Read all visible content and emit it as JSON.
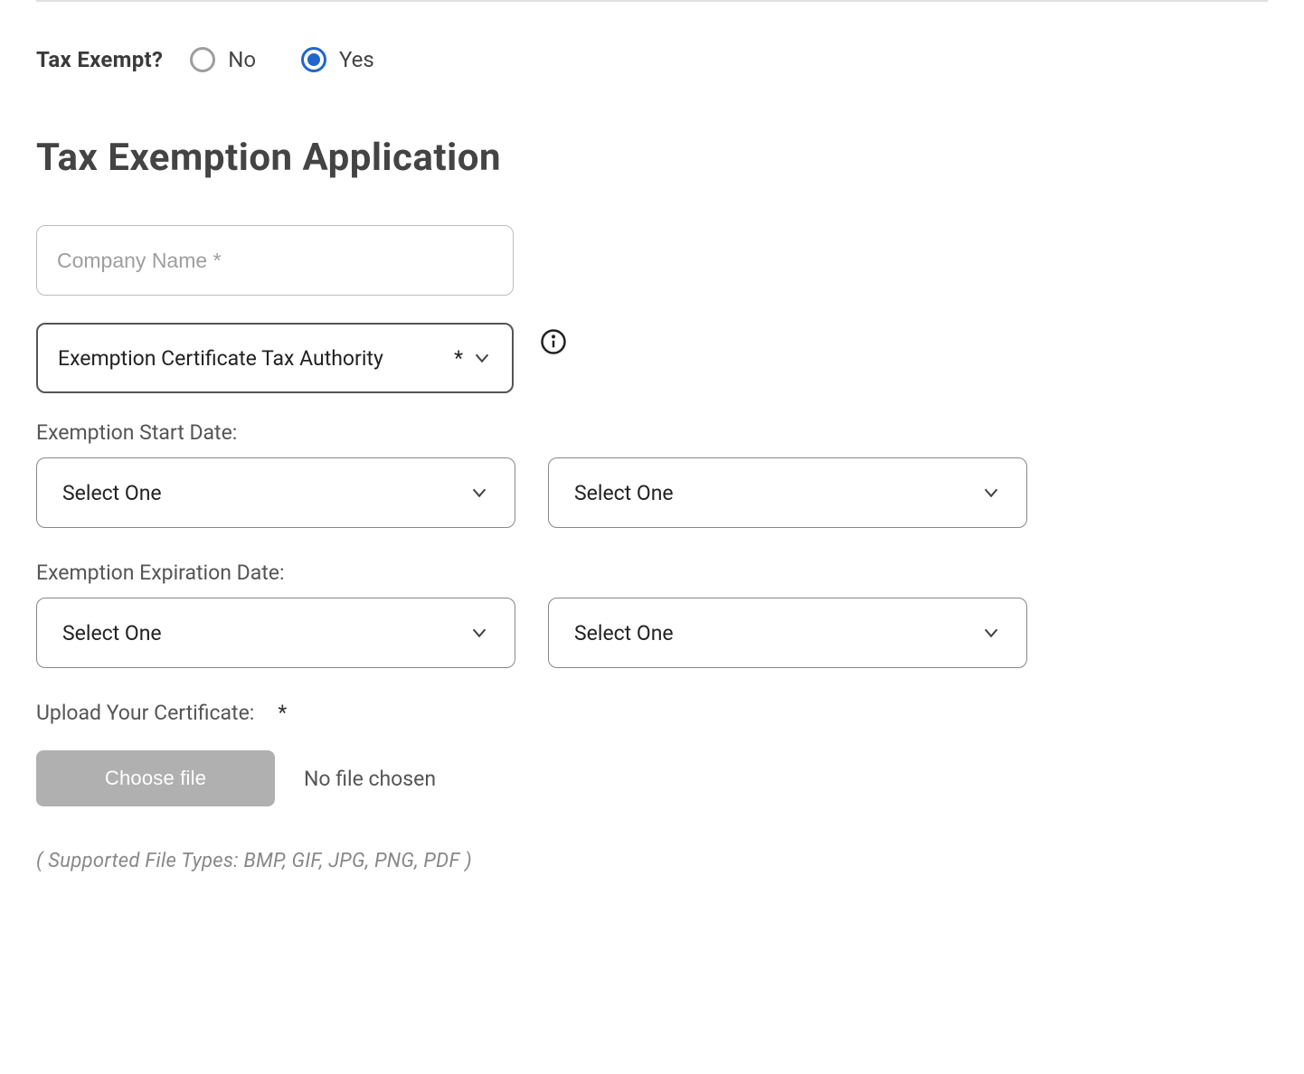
{
  "taxExempt": {
    "label": "Tax Exempt?",
    "options": {
      "no": "No",
      "yes": "Yes"
    },
    "selected": "yes"
  },
  "heading": "Tax Exemption Application",
  "companyName": {
    "placeholder": "Company Name *",
    "value": ""
  },
  "certificateAuthority": {
    "label": "Exemption Certificate Tax Authority",
    "asterisk": "*"
  },
  "startDate": {
    "label": "Exemption Start Date:",
    "select1": "Select One",
    "select2": "Select One"
  },
  "expirationDate": {
    "label": "Exemption Expiration Date:",
    "select1": "Select One",
    "select2": "Select One"
  },
  "upload": {
    "label": "Upload Your Certificate:",
    "asterisk": "*",
    "button": "Choose file",
    "status": "No file chosen"
  },
  "supportedTypes": "( Supported File Types:   BMP, GIF, JPG, PNG, PDF )"
}
